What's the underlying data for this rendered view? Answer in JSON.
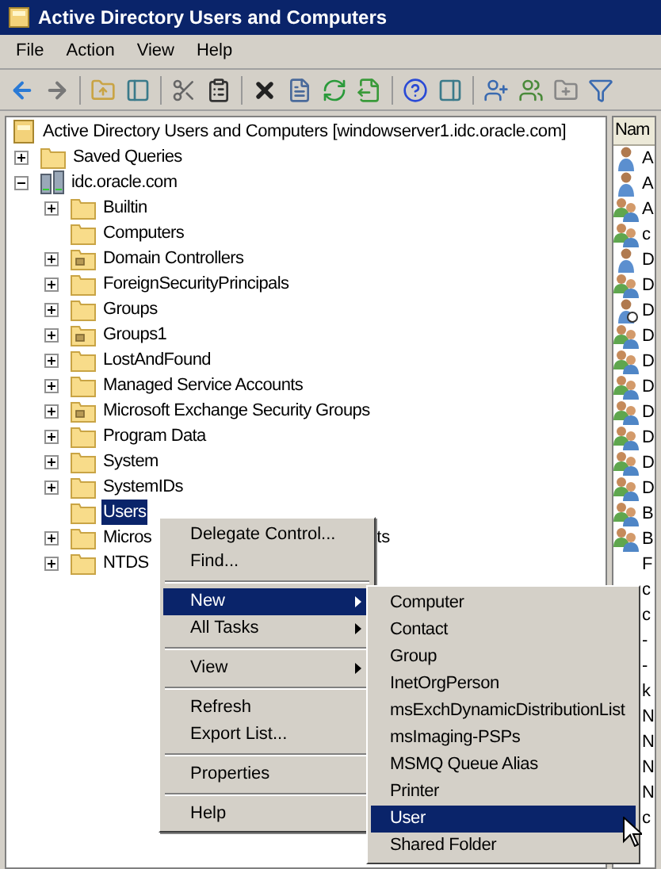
{
  "window": {
    "title": "Active Directory Users and Computers"
  },
  "menu_bar": [
    "File",
    "Action",
    "View",
    "Help"
  ],
  "tree": {
    "label": "Active Directory Users and Computers [windowserver1.idc.oracle.com]",
    "kind": "snapin",
    "children": [
      {
        "label": "Saved Queries",
        "kind": "folder",
        "has_children": true,
        "expanded": false,
        "selected": false
      },
      {
        "label": "idc.oracle.com",
        "kind": "domain",
        "has_children": true,
        "expanded": true,
        "selected": false,
        "children": [
          {
            "label": "Builtin",
            "kind": "folder",
            "has_children": true,
            "expanded": false,
            "selected": false
          },
          {
            "label": "Computers",
            "kind": "folder",
            "has_children": false,
            "selected": false
          },
          {
            "label": "Domain Controllers",
            "kind": "ou",
            "has_children": true,
            "expanded": false,
            "selected": false
          },
          {
            "label": "ForeignSecurityPrincipals",
            "kind": "folder",
            "has_children": true,
            "expanded": false,
            "selected": false
          },
          {
            "label": "Groups",
            "kind": "folder",
            "has_children": true,
            "expanded": false,
            "selected": false
          },
          {
            "label": "Groups1",
            "kind": "ou",
            "has_children": true,
            "expanded": false,
            "selected": false
          },
          {
            "label": "LostAndFound",
            "kind": "folder",
            "has_children": true,
            "expanded": false,
            "selected": false
          },
          {
            "label": "Managed Service Accounts",
            "kind": "folder",
            "has_children": true,
            "expanded": false,
            "selected": false
          },
          {
            "label": "Microsoft Exchange Security Groups",
            "kind": "ou",
            "has_children": true,
            "expanded": false,
            "selected": false
          },
          {
            "label": "Program Data",
            "kind": "folder",
            "has_children": true,
            "expanded": false,
            "selected": false
          },
          {
            "label": "System",
            "kind": "folder",
            "has_children": true,
            "expanded": false,
            "selected": false
          },
          {
            "label": "SystemIDs",
            "kind": "folder",
            "has_children": true,
            "expanded": false,
            "selected": false
          },
          {
            "label": "Users",
            "kind": "folder",
            "has_children": false,
            "selected": true
          },
          {
            "label": "Micros",
            "label_end": "ts",
            "kind": "folder",
            "has_children": true,
            "expanded": false,
            "selected": false
          },
          {
            "label": "NTDS",
            "kind": "folder",
            "has_children": true,
            "expanded": false,
            "selected": false
          }
        ]
      }
    ]
  },
  "list_pane": {
    "column": "Nam",
    "rows": [
      {
        "text": "A",
        "kind": "user"
      },
      {
        "text": "A",
        "kind": "user"
      },
      {
        "text": "A",
        "kind": "group"
      },
      {
        "text": "c",
        "kind": "group"
      },
      {
        "text": "D",
        "kind": "user"
      },
      {
        "text": "D",
        "kind": "group"
      },
      {
        "text": "D",
        "kind": "disabled-user"
      },
      {
        "text": "D",
        "kind": "group"
      },
      {
        "text": "D",
        "kind": "group"
      },
      {
        "text": "D",
        "kind": "group"
      },
      {
        "text": "D",
        "kind": "group"
      },
      {
        "text": "D",
        "kind": "group"
      },
      {
        "text": "D",
        "kind": "group"
      },
      {
        "text": "D",
        "kind": "group"
      },
      {
        "text": "B",
        "kind": "group"
      },
      {
        "text": "B",
        "kind": "group"
      },
      {
        "text": "F"
      },
      {
        "text": "c"
      },
      {
        "text": "c"
      },
      {
        "text": "-"
      },
      {
        "text": "-"
      },
      {
        "text": "k"
      },
      {
        "text": "N"
      },
      {
        "text": "N"
      },
      {
        "text": "N"
      },
      {
        "text": "N"
      },
      {
        "text": "c"
      }
    ]
  },
  "context_menu": [
    {
      "kind": "item",
      "label": "Delegate Control...",
      "submenu": false,
      "selected": false
    },
    {
      "kind": "item",
      "label": "Find...",
      "submenu": false,
      "selected": false
    },
    {
      "kind": "separator"
    },
    {
      "kind": "item",
      "label": "New",
      "submenu": true,
      "selected": true
    },
    {
      "kind": "item",
      "label": "All Tasks",
      "submenu": true,
      "selected": false
    },
    {
      "kind": "separator"
    },
    {
      "kind": "item",
      "label": "View",
      "submenu": true,
      "selected": false
    },
    {
      "kind": "separator"
    },
    {
      "kind": "item",
      "label": "Refresh",
      "submenu": false,
      "selected": false
    },
    {
      "kind": "item",
      "label": "Export List...",
      "submenu": false,
      "selected": false
    },
    {
      "kind": "separator"
    },
    {
      "kind": "item",
      "label": "Properties",
      "submenu": false,
      "selected": false
    },
    {
      "kind": "separator"
    },
    {
      "kind": "item",
      "label": "Help",
      "submenu": false,
      "selected": false
    }
  ],
  "submenu": [
    {
      "label": "Computer",
      "selected": false
    },
    {
      "label": "Contact",
      "selected": false
    },
    {
      "label": "Group",
      "selected": false
    },
    {
      "label": "InetOrgPerson",
      "selected": false
    },
    {
      "label": "msExchDynamicDistributionList",
      "selected": false
    },
    {
      "label": "msImaging-PSPs",
      "selected": false
    },
    {
      "label": "MSMQ Queue Alias",
      "selected": false
    },
    {
      "label": "Printer",
      "selected": false
    },
    {
      "label": "User",
      "selected": true
    },
    {
      "label": "Shared Folder",
      "selected": false
    }
  ]
}
